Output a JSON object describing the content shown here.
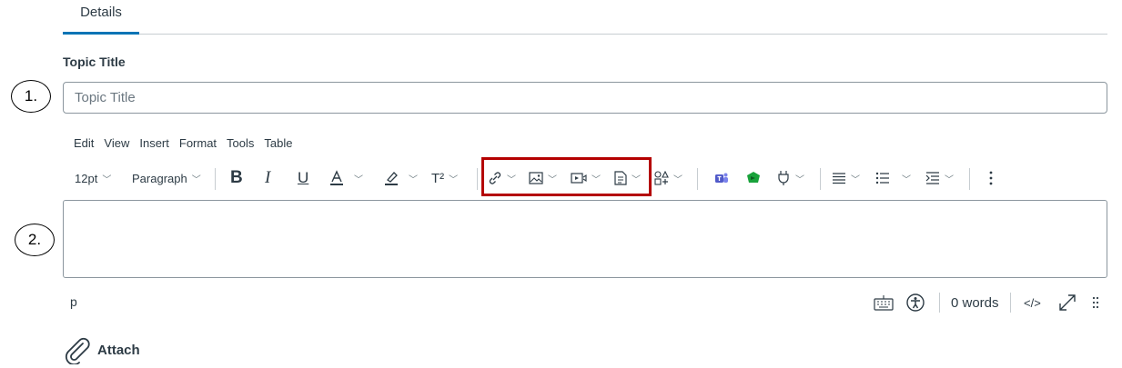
{
  "tabs": {
    "details": "Details"
  },
  "topic": {
    "label": "Topic Title",
    "placeholder": "Topic Title"
  },
  "callouts": {
    "one": "1.",
    "two": "2."
  },
  "menubar": {
    "edit": "Edit",
    "view": "View",
    "insert": "Insert",
    "format": "Format",
    "tools": "Tools",
    "table": "Table"
  },
  "toolbar": {
    "font_size": "12pt",
    "block_format": "Paragraph",
    "superscript_label": "T²",
    "highlight_color": "#b40000",
    "icons": [
      "bold-icon",
      "italic-icon",
      "underline-icon",
      "text-color-icon",
      "highlight-icon",
      "superscript-icon",
      "link-icon",
      "image-icon",
      "media-icon",
      "document-icon",
      "apps-icon",
      "teams-icon",
      "studio-icon",
      "plugin-icon",
      "align-icon",
      "list-icon",
      "indent-icon",
      "more-icon"
    ]
  },
  "statusbar": {
    "path": "p",
    "word_count": "0 words",
    "html_toggle": "</>"
  },
  "attach": {
    "label": "Attach"
  },
  "colors": {
    "accent": "#0374b5",
    "text": "#2d3b45",
    "border": "#8b969e"
  }
}
